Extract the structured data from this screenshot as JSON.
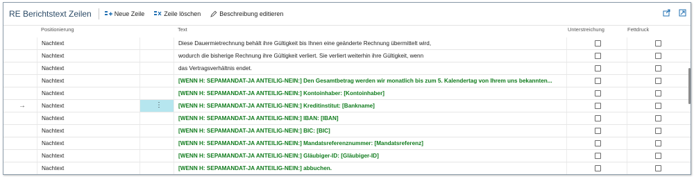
{
  "page": {
    "title": "RE Berichtstext Zeilen"
  },
  "toolbar": {
    "new_line": "Neue Zeile",
    "delete_line": "Zeile löschen",
    "edit_description": "Beschreibung editieren"
  },
  "columns": {
    "positioning": "Positionierung",
    "text": "Text",
    "underline": "Unterstreichung",
    "bold": "Fettdruck"
  },
  "rows": [
    {
      "pos": "Nachtext",
      "text": "Diese Dauermietrechnung behält ihre Gültigkeit bis Ihnen eine geänderte Rechnung übermittelt wird,"
    },
    {
      "pos": "Nachtext",
      "text": "wodurch die bisherige Rechnung ihre Gültigkeit verliert. Sie verliert weiterhin ihre Gültigkeit, wenn"
    },
    {
      "pos": "Nachtext",
      "text": "das Vertragsverhältnis endet."
    },
    {
      "pos": "Nachtext",
      "text": "[WENN H: SEPAMANDAT-JA ANTEILIG-NEIN:] Den Gesamtbetrag werden wir monatlich bis zum 5. Kalendertag von Ihrem uns bekannten..."
    },
    {
      "pos": "Nachtext",
      "text": "[WENN H: SEPAMANDAT-JA ANTEILIG-NEIN:] Kontoinhaber: [Kontoinhaber]"
    },
    {
      "pos": "Nachtext",
      "text": "[WENN H: SEPAMANDAT-JA ANTEILIG-NEIN:] Kreditinstitut: [Bankname]"
    },
    {
      "pos": "Nachtext",
      "text": "[WENN H: SEPAMANDAT-JA ANTEILIG-NEIN:] IBAN: [IBAN]"
    },
    {
      "pos": "Nachtext",
      "text": "[WENN H: SEPAMANDAT-JA ANTEILIG-NEIN:] BIC: [BIC]"
    },
    {
      "pos": "Nachtext",
      "text": "[WENN H: SEPAMANDAT-JA ANTEILIG-NEIN:] Mandatsreferenznummer: [Mandatsreferenz]"
    },
    {
      "pos": "Nachtext",
      "text": "[WENN H: SEPAMANDAT-JA ANTEILIG-NEIN:] Gläubiger-ID: [Gläubiger-ID]"
    },
    {
      "pos": "Nachtext",
      "text": "[WENN H: SEPAMANDAT-JA ANTEILIG-NEIN:] abbuchen."
    }
  ],
  "row_marker": "→",
  "row_menu": "⋮",
  "colors": {
    "green_text": "#0f7b1c",
    "selected_cell": "#b6e6ef",
    "title": "#2b4a66",
    "accent": "#1f6fb2"
  }
}
